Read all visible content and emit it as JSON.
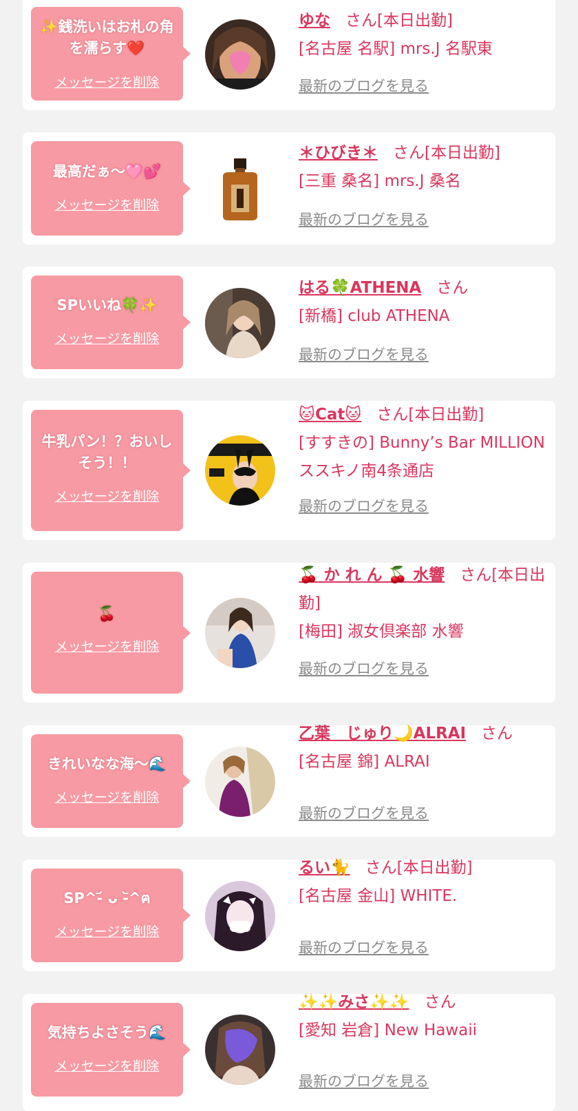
{
  "colors": {
    "accent": "#d9365d",
    "bubble": "#f89aa3",
    "background": "#f2f2f2",
    "link_gray": "#8a8a8a"
  },
  "cards": [
    {
      "message": "✨銭洗いはお札の角を濡らす❤️",
      "delete_label": "メッセージを削除",
      "cast_name": "ゆな",
      "honorific": "さん[本日出勤]",
      "shop": "[名古屋 名駅] mrs.J 名駅東",
      "blog_label": "最新のブログを見る",
      "avatar_icon": "avatar-photo-icon"
    },
    {
      "message": "最高だぁ〜🩷💕",
      "delete_label": "メッセージを削除",
      "cast_name": "＊ひびき＊",
      "honorific": "さん[本日出勤]",
      "shop": "[三重 桑名] mrs.J 桑名",
      "blog_label": "最新のブログを見る",
      "avatar_icon": "whisky-bottle-icon"
    },
    {
      "message": "SPいいね🍀✨",
      "delete_label": "メッセージを削除",
      "cast_name": "はる🍀ATHENA",
      "honorific": "さん",
      "shop": "[新橋] club ATHENA",
      "blog_label": "最新のブログを見る",
      "avatar_icon": "avatar-photo-icon"
    },
    {
      "message": "牛乳パン！？おいしそう！！",
      "delete_label": "メッセージを削除",
      "cast_name": "🐱Cat🐱",
      "honorific": "さん[本日出勤]",
      "shop": "[すすきの] Bunny’s Bar MILLION ススキノ南4条通店",
      "blog_label": "最新のブログを見る",
      "avatar_icon": "magazine-cover-icon"
    },
    {
      "message": "🍒",
      "delete_label": "メッセージを削除",
      "cast_name": "🍒 か れ ん 🍒 水響",
      "honorific": "さん[本日出勤]",
      "shop": "[梅田] 淑女倶楽部 水響",
      "blog_label": "最新のブログを見る",
      "avatar_icon": "avatar-photo-icon"
    },
    {
      "message": "きれいなな海〜🌊",
      "delete_label": "メッセージを削除",
      "cast_name": "乙葉　じゅり🌙ALRAI",
      "honorific": "さん",
      "shop": "[名古屋 錦] ALRAI",
      "blog_label": "最新のブログを見る",
      "avatar_icon": "avatar-photo-icon"
    },
    {
      "message": "SP^-᷄ ᴗ -᷅^ฅ",
      "delete_label": "メッセージを削除",
      "cast_name": "るい🐈",
      "honorific": "さん[本日出勤]",
      "shop": "[名古屋 金山] WHITE.",
      "blog_label": "最新のブログを見る",
      "avatar_icon": "avatar-photo-icon"
    },
    {
      "message": "気持ちよさそう🌊",
      "delete_label": "メッセージを削除",
      "cast_name": "✨✨みさ✨✨",
      "honorific": "さん",
      "shop": "[愛知 岩倉] New Hawaii",
      "blog_label": "最新のブログを見る",
      "avatar_icon": "avatar-photo-icon"
    }
  ]
}
